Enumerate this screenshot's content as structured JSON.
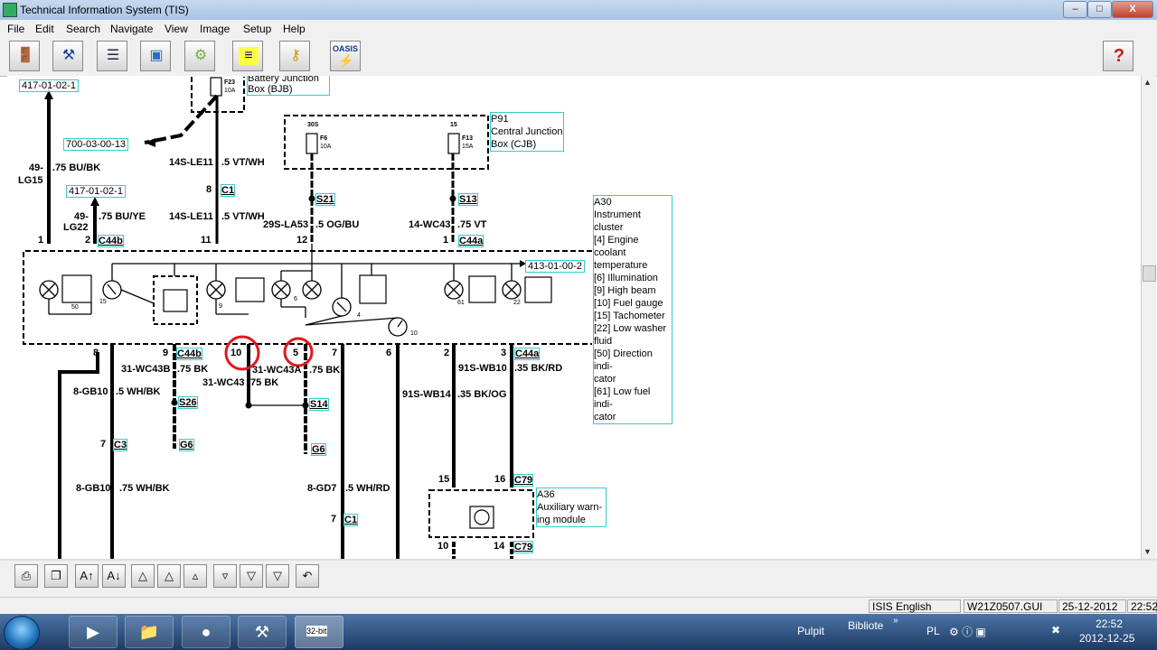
{
  "window": {
    "title": "Technical Information System (TIS)",
    "buttons": [
      "–",
      "□",
      "X"
    ]
  },
  "menu": [
    "File",
    "Edit",
    "Search",
    "Navigate",
    "View",
    "Image",
    "Setup",
    "Help"
  ],
  "toolbar": {
    "buttons": [
      {
        "name": "exit",
        "icon": "door-icon"
      },
      {
        "name": "tools",
        "icon": "wrench-icon"
      },
      {
        "name": "document",
        "icon": "document-icon"
      },
      {
        "name": "vehicle",
        "icon": "vehicle-icon"
      },
      {
        "name": "component",
        "icon": "chip-icon"
      },
      {
        "name": "notebook",
        "icon": "notebook-icon"
      },
      {
        "name": "key",
        "icon": "key-icon"
      },
      {
        "name": "oasis",
        "icon": "oasis-icon",
        "label": "OASIS"
      }
    ],
    "help_icon": "help-icon"
  },
  "diagram": {
    "refs": [
      "417-01-02-1",
      "700-03-00-13",
      "417-01-02-1",
      "413-01-00-2"
    ],
    "bjb_label": "Battery Junction Box (BJB)",
    "bjb_fuse": {
      "id": "F23",
      "amp": "10A"
    },
    "cjb_label": [
      "P91",
      "Central Junction",
      "Box (CJB)"
    ],
    "cjb_fuses": [
      {
        "pin": "30S",
        "id": "F6",
        "amp": "10A"
      },
      {
        "pin": "15",
        "id": "F13",
        "amp": "15A"
      }
    ],
    "a30_label": [
      "A30",
      "Instrument cluster",
      "[4] Engine coolant",
      "temperature",
      "[6] Illumination",
      "[9] High beam",
      "[10] Fuel gauge",
      "[15] Tachometer",
      "[22] Low washer",
      "fluid",
      "[50] Direction indi-",
      "cator",
      "[61] Low fuel indi-",
      "cator"
    ],
    "a36_label": [
      "A36",
      "Auxiliary warn-",
      "ing module"
    ],
    "connectors": [
      "C44b",
      "C1",
      "S21",
      "S13",
      "C44a",
      "C44b",
      "S26",
      "G6",
      "S14",
      "G6",
      "C44a",
      "C3",
      "C1",
      "C79",
      "C79"
    ],
    "wires": [
      {
        "circuit": "49-",
        "circuit2": "LG15",
        "spec": ".75 BU/BK"
      },
      {
        "circuit": "49-",
        "circuit2": "LG22",
        "spec": ".75 BU/YE"
      },
      {
        "circuit": "14S-LE11",
        "spec": ".5 VT/WH"
      },
      {
        "circuit": "14S-LE11",
        "spec": ".5 VT/WH"
      },
      {
        "circuit": "29S-LA53",
        "spec": ".5 OG/BU"
      },
      {
        "circuit": "14-WC43",
        "spec": ".75 VT"
      },
      {
        "circuit": "31-WC43B",
        "spec": ".75 BK"
      },
      {
        "circuit": "31-WC43A",
        "spec": ".75 BK"
      },
      {
        "circuit": "31-WC43",
        "spec": ".75 BK"
      },
      {
        "circuit": "8-GB10",
        "spec": ".5 WH/BK"
      },
      {
        "circuit": "8-GB10",
        "spec": ".75 WH/BK"
      },
      {
        "circuit": "8-GD7",
        "spec": ".5 WH/RD"
      },
      {
        "circuit": "91S-WB10",
        "spec": ".35 BK/RD"
      },
      {
        "circuit": "91S-WB14",
        "spec": ".35 BK/OG"
      }
    ],
    "pins": [
      "1",
      "2",
      "11",
      "12",
      "1",
      "8",
      "8",
      "9",
      "10",
      "5",
      "7",
      "6",
      "2",
      "3",
      "7",
      "7",
      "15",
      "16",
      "10",
      "14"
    ],
    "small_pins": [
      "50",
      "15",
      "9",
      "6",
      "4",
      "10",
      "61",
      "22"
    ]
  },
  "bottom_toolbar": [
    "print-icon",
    "copy-icon",
    "font-increase-icon",
    "font-decrease-icon",
    "first-page-icon",
    "prev-section-icon",
    "prev-page-icon",
    "next-page-icon",
    "next-section-icon",
    "last-page-icon",
    "back-icon"
  ],
  "status": {
    "lang": "ISIS English",
    "file": "W21Z0507.GUI",
    "date": "25-12-2012",
    "time": "22:52"
  },
  "taskbar": {
    "tasks": [
      "media-player-icon",
      "folder-icon",
      "firefox-icon",
      "tools-icon",
      "tis-icon"
    ],
    "tis_label": "32-bit",
    "pulpit": "Pulpit",
    "biblioteki": "Bibliote",
    "lang": "PL",
    "clock_time": "22:52",
    "clock_date": "2012-12-25"
  }
}
